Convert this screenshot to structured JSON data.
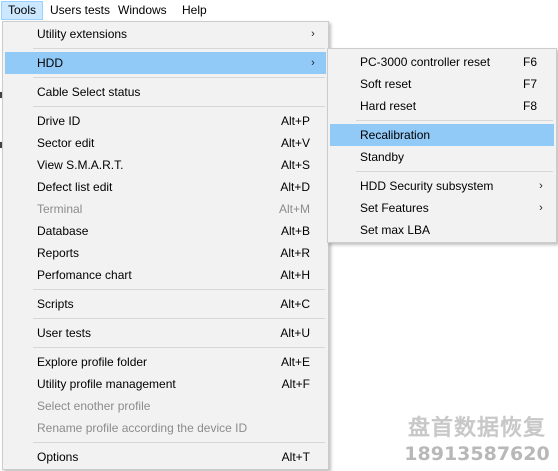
{
  "menubar": {
    "items": [
      {
        "label": "Tools",
        "active": true
      },
      {
        "label": "Users tests"
      },
      {
        "label": "Windows"
      },
      {
        "label": "Help"
      }
    ]
  },
  "tools_menu": {
    "items": [
      {
        "label": "Utility extensions",
        "submenu": true
      },
      {
        "label": "HDD",
        "submenu": true,
        "highlighted": true
      },
      {
        "label": "Cable Select status"
      },
      {
        "label": "Drive ID",
        "shortcut": "Alt+P"
      },
      {
        "label": "Sector edit",
        "shortcut": "Alt+V"
      },
      {
        "label": "View S.M.A.R.T.",
        "shortcut": "Alt+S"
      },
      {
        "label": "Defect list edit",
        "shortcut": "Alt+D"
      },
      {
        "label": "Terminal",
        "shortcut": "Alt+M",
        "disabled": true
      },
      {
        "label": "Database",
        "shortcut": "Alt+B"
      },
      {
        "label": "Reports",
        "shortcut": "Alt+R"
      },
      {
        "label": "Perfomance chart",
        "shortcut": "Alt+H"
      },
      {
        "label": "Scripts",
        "shortcut": "Alt+C"
      },
      {
        "label": "User tests",
        "shortcut": "Alt+U"
      },
      {
        "label": "Explore profile folder",
        "shortcut": "Alt+E"
      },
      {
        "label": "Utility profile management",
        "shortcut": "Alt+F"
      },
      {
        "label": "Select enother profile",
        "disabled": true
      },
      {
        "label": "Rename profile according the device ID",
        "disabled": true
      },
      {
        "label": "Options",
        "shortcut": "Alt+T"
      }
    ]
  },
  "hdd_submenu": {
    "items": [
      {
        "label": "PC-3000 controller reset",
        "shortcut": "F6"
      },
      {
        "label": "Soft reset",
        "shortcut": "F7"
      },
      {
        "label": "Hard reset",
        "shortcut": "F8"
      },
      {
        "label": "Recalibration",
        "highlighted": true
      },
      {
        "label": "Standby"
      },
      {
        "label": "HDD Security subsystem",
        "submenu": true
      },
      {
        "label": "Set Features",
        "submenu": true
      },
      {
        "label": "Set max LBA"
      }
    ]
  },
  "icons": {
    "submenu_arrow": "chevron-right-icon",
    "arrow_glyph": "›"
  },
  "colors": {
    "highlight": "#91c9f7",
    "menu_bg": "#f2f2f2",
    "disabled_text": "#8c8c8c",
    "menubar_active": "#cce8ff"
  },
  "watermark": {
    "line1": "盘首数据恢复",
    "line2": "18913587620"
  }
}
